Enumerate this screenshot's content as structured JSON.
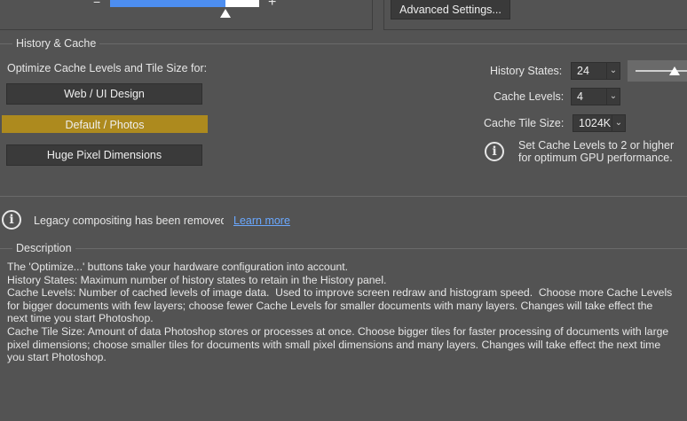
{
  "top": {
    "minus": "−",
    "plus": "+",
    "advanced_label": "Advanced Settings..."
  },
  "history_cache": {
    "title": "History & Cache",
    "optimize_label": "Optimize Cache Levels and Tile Size for:",
    "buttons": [
      "Web / UI Design",
      "Default / Photos",
      "Huge Pixel Dimensions"
    ],
    "selected": "Default / Photos",
    "history_states_label": "History States:",
    "history_states_value": "24",
    "cache_levels_label": "Cache Levels:",
    "cache_levels_value": "4",
    "cache_tile_label": "Cache Tile Size:",
    "cache_tile_value": "1024K",
    "gpu_tip_line1": "Set Cache Levels to 2 or higher",
    "gpu_tip_line2": "for optimum GPU performance."
  },
  "legacy": {
    "message": "Legacy compositing has been removed",
    "link": "Learn more"
  },
  "description": {
    "title": "Description",
    "lines": [
      "The 'Optimize...' buttons take your hardware configuration into account.",
      "History States: Maximum number of history states to retain in the History panel.",
      "Cache Levels: Number of cached levels of image data.  Used to improve screen redraw and histogram speed.  Choose more Cache Levels",
      "for bigger documents with few layers; choose fewer Cache Levels for smaller documents with many layers. Changes will take effect the",
      "next time you start Photoshop.",
      "Cache Tile Size: Amount of data Photoshop stores or processes at once. Choose bigger tiles for faster processing of documents with large",
      "pixel dimensions; choose smaller tiles for documents with small pixel dimensions and many layers. Changes will take effect the next time",
      "you start Photoshop."
    ]
  },
  "colors": {
    "background": "#535353",
    "selected_button": "#ad8a1e",
    "slider_fill": "#4d8ef0",
    "link": "#6aa8ff"
  },
  "icons": {
    "info": "info-circle-icon",
    "chevron": "chevron-down-icon"
  }
}
